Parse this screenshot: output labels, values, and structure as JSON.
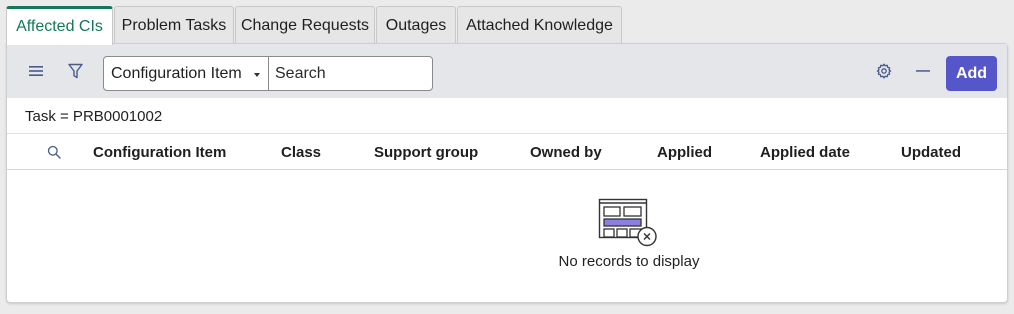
{
  "tabs": [
    {
      "label": "Affected CIs",
      "active": true
    },
    {
      "label": "Problem Tasks",
      "active": false
    },
    {
      "label": "Change Requests",
      "active": false
    },
    {
      "label": "Outages",
      "active": false
    },
    {
      "label": "Attached Knowledge",
      "active": false
    }
  ],
  "toolbar": {
    "menu_icon": "hamburger-menu-icon",
    "filter_icon": "filter-funnel-icon",
    "field_select": "Configuration Item",
    "search_placeholder": "Search",
    "settings_icon": "gear-icon",
    "collapse_icon": "minus-icon",
    "add_label": "Add"
  },
  "filter": {
    "text": "Task = PRB0001002"
  },
  "columns": [
    "Configuration Item",
    "Class",
    "Support group",
    "Owned by",
    "Applied",
    "Applied date",
    "Updated"
  ],
  "empty_state": {
    "icon": "empty-table-icon",
    "message": "No records to display"
  },
  "colors": {
    "active_tab": "#16785a",
    "add_button": "#5556c9",
    "toolbar_bg": "#e4e6ea",
    "empty_icon_accent": "#8b7fe0"
  }
}
